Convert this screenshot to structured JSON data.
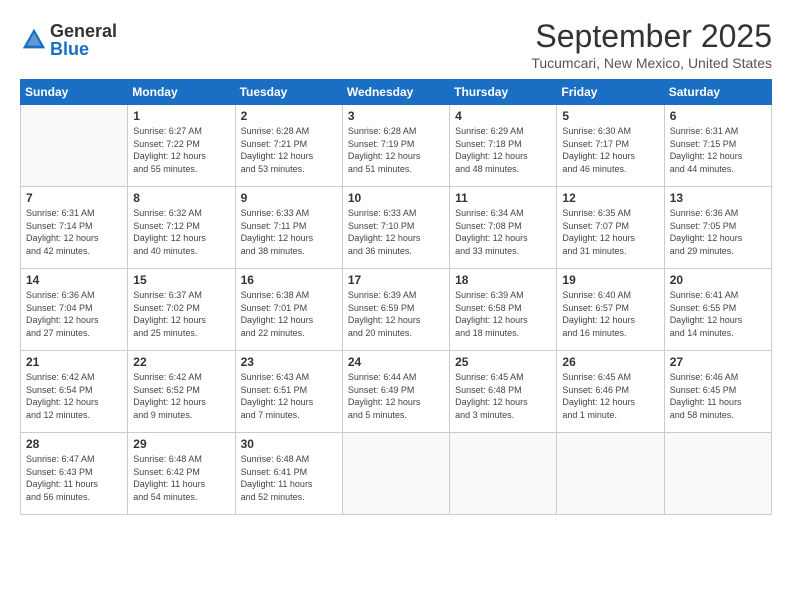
{
  "logo": {
    "general": "General",
    "blue": "Blue"
  },
  "header": {
    "title": "September 2025",
    "location": "Tucumcari, New Mexico, United States"
  },
  "weekdays": [
    "Sunday",
    "Monday",
    "Tuesday",
    "Wednesday",
    "Thursday",
    "Friday",
    "Saturday"
  ],
  "weeks": [
    [
      {
        "day": "",
        "info": ""
      },
      {
        "day": "1",
        "info": "Sunrise: 6:27 AM\nSunset: 7:22 PM\nDaylight: 12 hours\nand 55 minutes."
      },
      {
        "day": "2",
        "info": "Sunrise: 6:28 AM\nSunset: 7:21 PM\nDaylight: 12 hours\nand 53 minutes."
      },
      {
        "day": "3",
        "info": "Sunrise: 6:28 AM\nSunset: 7:19 PM\nDaylight: 12 hours\nand 51 minutes."
      },
      {
        "day": "4",
        "info": "Sunrise: 6:29 AM\nSunset: 7:18 PM\nDaylight: 12 hours\nand 48 minutes."
      },
      {
        "day": "5",
        "info": "Sunrise: 6:30 AM\nSunset: 7:17 PM\nDaylight: 12 hours\nand 46 minutes."
      },
      {
        "day": "6",
        "info": "Sunrise: 6:31 AM\nSunset: 7:15 PM\nDaylight: 12 hours\nand 44 minutes."
      }
    ],
    [
      {
        "day": "7",
        "info": "Sunrise: 6:31 AM\nSunset: 7:14 PM\nDaylight: 12 hours\nand 42 minutes."
      },
      {
        "day": "8",
        "info": "Sunrise: 6:32 AM\nSunset: 7:12 PM\nDaylight: 12 hours\nand 40 minutes."
      },
      {
        "day": "9",
        "info": "Sunrise: 6:33 AM\nSunset: 7:11 PM\nDaylight: 12 hours\nand 38 minutes."
      },
      {
        "day": "10",
        "info": "Sunrise: 6:33 AM\nSunset: 7:10 PM\nDaylight: 12 hours\nand 36 minutes."
      },
      {
        "day": "11",
        "info": "Sunrise: 6:34 AM\nSunset: 7:08 PM\nDaylight: 12 hours\nand 33 minutes."
      },
      {
        "day": "12",
        "info": "Sunrise: 6:35 AM\nSunset: 7:07 PM\nDaylight: 12 hours\nand 31 minutes."
      },
      {
        "day": "13",
        "info": "Sunrise: 6:36 AM\nSunset: 7:05 PM\nDaylight: 12 hours\nand 29 minutes."
      }
    ],
    [
      {
        "day": "14",
        "info": "Sunrise: 6:36 AM\nSunset: 7:04 PM\nDaylight: 12 hours\nand 27 minutes."
      },
      {
        "day": "15",
        "info": "Sunrise: 6:37 AM\nSunset: 7:02 PM\nDaylight: 12 hours\nand 25 minutes."
      },
      {
        "day": "16",
        "info": "Sunrise: 6:38 AM\nSunset: 7:01 PM\nDaylight: 12 hours\nand 22 minutes."
      },
      {
        "day": "17",
        "info": "Sunrise: 6:39 AM\nSunset: 6:59 PM\nDaylight: 12 hours\nand 20 minutes."
      },
      {
        "day": "18",
        "info": "Sunrise: 6:39 AM\nSunset: 6:58 PM\nDaylight: 12 hours\nand 18 minutes."
      },
      {
        "day": "19",
        "info": "Sunrise: 6:40 AM\nSunset: 6:57 PM\nDaylight: 12 hours\nand 16 minutes."
      },
      {
        "day": "20",
        "info": "Sunrise: 6:41 AM\nSunset: 6:55 PM\nDaylight: 12 hours\nand 14 minutes."
      }
    ],
    [
      {
        "day": "21",
        "info": "Sunrise: 6:42 AM\nSunset: 6:54 PM\nDaylight: 12 hours\nand 12 minutes."
      },
      {
        "day": "22",
        "info": "Sunrise: 6:42 AM\nSunset: 6:52 PM\nDaylight: 12 hours\nand 9 minutes."
      },
      {
        "day": "23",
        "info": "Sunrise: 6:43 AM\nSunset: 6:51 PM\nDaylight: 12 hours\nand 7 minutes."
      },
      {
        "day": "24",
        "info": "Sunrise: 6:44 AM\nSunset: 6:49 PM\nDaylight: 12 hours\nand 5 minutes."
      },
      {
        "day": "25",
        "info": "Sunrise: 6:45 AM\nSunset: 6:48 PM\nDaylight: 12 hours\nand 3 minutes."
      },
      {
        "day": "26",
        "info": "Sunrise: 6:45 AM\nSunset: 6:46 PM\nDaylight: 12 hours\nand 1 minute."
      },
      {
        "day": "27",
        "info": "Sunrise: 6:46 AM\nSunset: 6:45 PM\nDaylight: 11 hours\nand 58 minutes."
      }
    ],
    [
      {
        "day": "28",
        "info": "Sunrise: 6:47 AM\nSunset: 6:43 PM\nDaylight: 11 hours\nand 56 minutes."
      },
      {
        "day": "29",
        "info": "Sunrise: 6:48 AM\nSunset: 6:42 PM\nDaylight: 11 hours\nand 54 minutes."
      },
      {
        "day": "30",
        "info": "Sunrise: 6:48 AM\nSunset: 6:41 PM\nDaylight: 11 hours\nand 52 minutes."
      },
      {
        "day": "",
        "info": ""
      },
      {
        "day": "",
        "info": ""
      },
      {
        "day": "",
        "info": ""
      },
      {
        "day": "",
        "info": ""
      }
    ]
  ]
}
